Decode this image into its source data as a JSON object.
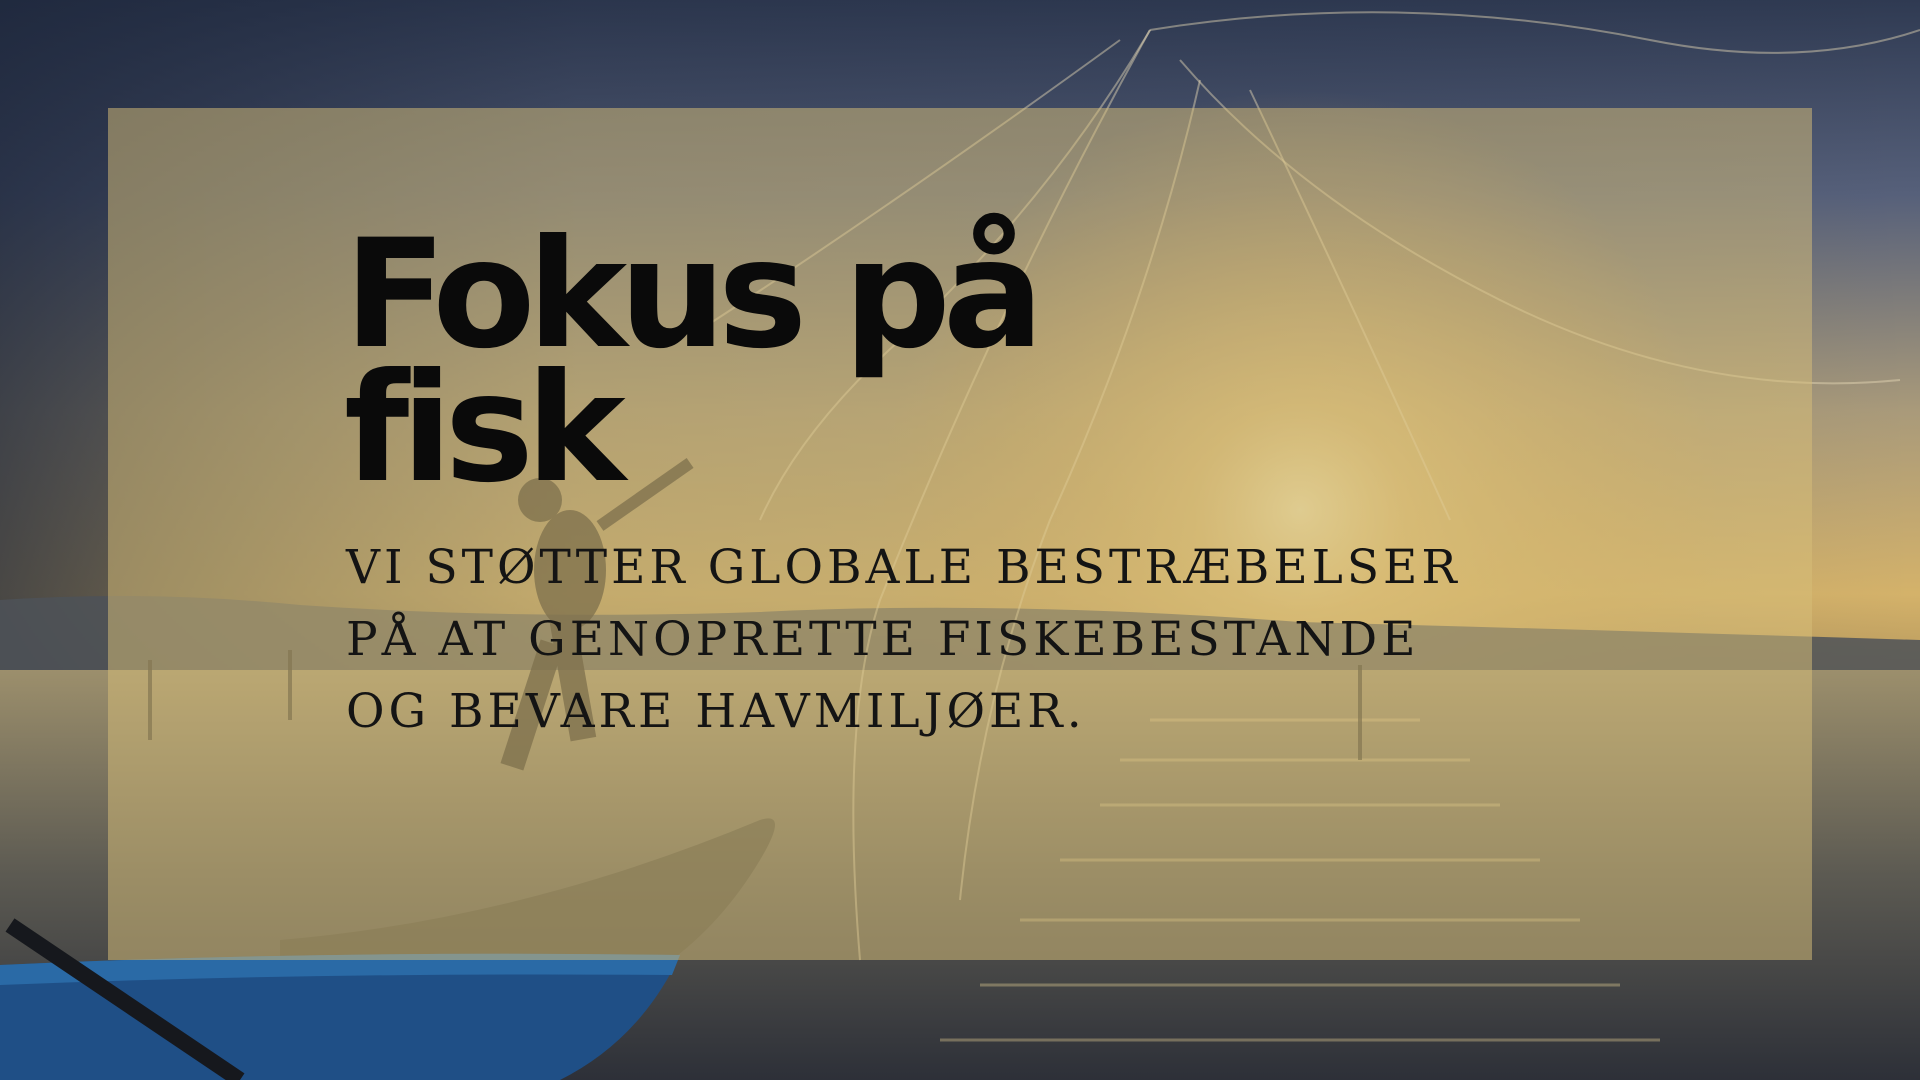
{
  "slide": {
    "title_lines": [
      "Fokus på",
      "fisk"
    ],
    "subtitle_lines": [
      "VI STØTTER GLOBALE BESTRÆBELSER",
      "PÅ AT GENOPRETTE FISKEBESTANDE",
      "OG BEVARE HAVMILJØER."
    ]
  },
  "colors": {
    "text": "#0a0a0a",
    "panel": "#d6be78",
    "sky_top": "#3a4660",
    "sun": "#f3d58a",
    "water": "#6f6652",
    "boat": "#1f4f86"
  }
}
